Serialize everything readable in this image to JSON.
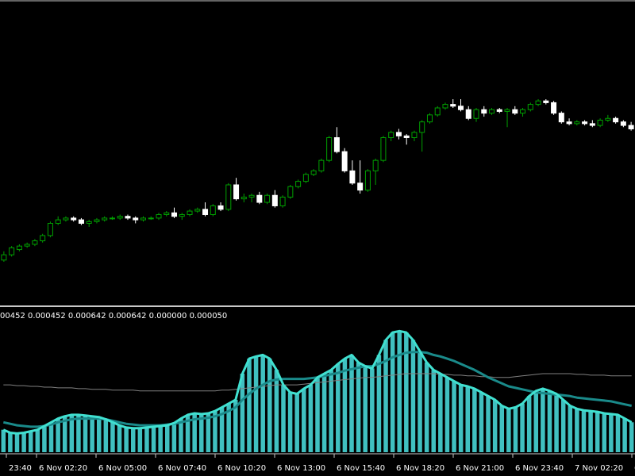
{
  "colors": {
    "background": "#000000",
    "frame": "#c8c8c8",
    "candle_up": "#00a000",
    "candle_down": "#ffffff",
    "histogram": "#40c0c0",
    "indicator_line": "#40e0d0",
    "signal_line": "#1a8a8a",
    "baseline_line": "#808080",
    "text": "#ffffff"
  },
  "indicator_readout": "00452 0.000452 0.000642 0.000642 0.000000 0.000050",
  "chart_data": [
    {
      "type": "candlestick",
      "title": "",
      "ohlc": [
        [
          0.28,
          0.33,
          0.27,
          0.31
        ],
        [
          0.31,
          0.36,
          0.3,
          0.35
        ],
        [
          0.34,
          0.37,
          0.33,
          0.36
        ],
        [
          0.36,
          0.38,
          0.35,
          0.37
        ],
        [
          0.37,
          0.4,
          0.36,
          0.39
        ],
        [
          0.39,
          0.43,
          0.38,
          0.42
        ],
        [
          0.42,
          0.5,
          0.41,
          0.49
        ],
        [
          0.49,
          0.53,
          0.48,
          0.51
        ],
        [
          0.51,
          0.53,
          0.5,
          0.52
        ],
        [
          0.52,
          0.53,
          0.5,
          0.51
        ],
        [
          0.51,
          0.52,
          0.48,
          0.49
        ],
        [
          0.49,
          0.51,
          0.47,
          0.5
        ],
        [
          0.5,
          0.52,
          0.49,
          0.51
        ],
        [
          0.51,
          0.53,
          0.5,
          0.52
        ],
        [
          0.52,
          0.53,
          0.51,
          0.52
        ],
        [
          0.52,
          0.54,
          0.51,
          0.53
        ],
        [
          0.53,
          0.54,
          0.51,
          0.52
        ],
        [
          0.52,
          0.53,
          0.49,
          0.51
        ],
        [
          0.51,
          0.53,
          0.5,
          0.52
        ],
        [
          0.52,
          0.53,
          0.51,
          0.52
        ],
        [
          0.52,
          0.55,
          0.51,
          0.54
        ],
        [
          0.54,
          0.56,
          0.53,
          0.55
        ],
        [
          0.55,
          0.58,
          0.52,
          0.53
        ],
        [
          0.53,
          0.55,
          0.51,
          0.54
        ],
        [
          0.54,
          0.57,
          0.53,
          0.56
        ],
        [
          0.56,
          0.58,
          0.55,
          0.57
        ],
        [
          0.57,
          0.61,
          0.53,
          0.54
        ],
        [
          0.54,
          0.6,
          0.53,
          0.59
        ],
        [
          0.59,
          0.61,
          0.56,
          0.57
        ],
        [
          0.57,
          0.72,
          0.56,
          0.71
        ],
        [
          0.71,
          0.75,
          0.62,
          0.63
        ],
        [
          0.63,
          0.66,
          0.61,
          0.64
        ],
        [
          0.64,
          0.66,
          0.61,
          0.65
        ],
        [
          0.65,
          0.67,
          0.6,
          0.61
        ],
        [
          0.61,
          0.66,
          0.6,
          0.65
        ],
        [
          0.65,
          0.68,
          0.58,
          0.59
        ],
        [
          0.59,
          0.65,
          0.58,
          0.64
        ],
        [
          0.64,
          0.71,
          0.63,
          0.7
        ],
        [
          0.7,
          0.74,
          0.69,
          0.73
        ],
        [
          0.73,
          0.78,
          0.72,
          0.77
        ],
        [
          0.77,
          0.8,
          0.76,
          0.79
        ],
        [
          0.79,
          0.86,
          0.78,
          0.85
        ],
        [
          0.85,
          0.99,
          0.84,
          0.98
        ],
        [
          0.98,
          1.04,
          0.89,
          0.9
        ],
        [
          0.9,
          0.92,
          0.78,
          0.79
        ],
        [
          0.79,
          0.85,
          0.71,
          0.72
        ],
        [
          0.72,
          0.85,
          0.66,
          0.68
        ],
        [
          0.68,
          0.8,
          0.67,
          0.79
        ],
        [
          0.79,
          0.86,
          0.71,
          0.85
        ],
        [
          0.85,
          0.99,
          0.84,
          0.98
        ],
        [
          0.98,
          1.02,
          0.96,
          1.01
        ],
        [
          1.01,
          1.03,
          0.97,
          0.99
        ],
        [
          0.99,
          1.0,
          0.94,
          0.98
        ],
        [
          0.98,
          1.02,
          0.96,
          1.01
        ],
        [
          1.01,
          1.08,
          0.9,
          1.07
        ],
        [
          1.07,
          1.12,
          1.06,
          1.11
        ],
        [
          1.11,
          1.16,
          1.1,
          1.15
        ],
        [
          1.15,
          1.18,
          1.14,
          1.17
        ],
        [
          1.17,
          1.2,
          1.15,
          1.16
        ],
        [
          1.16,
          1.2,
          1.13,
          1.14
        ],
        [
          1.14,
          1.16,
          1.08,
          1.09
        ],
        [
          1.09,
          1.15,
          1.07,
          1.14
        ],
        [
          1.14,
          1.16,
          1.1,
          1.12
        ],
        [
          1.12,
          1.15,
          1.11,
          1.14
        ],
        [
          1.14,
          1.15,
          1.12,
          1.13
        ],
        [
          1.13,
          1.15,
          1.04,
          1.14
        ],
        [
          1.14,
          1.16,
          1.11,
          1.12
        ],
        [
          1.12,
          1.15,
          1.1,
          1.14
        ],
        [
          1.14,
          1.18,
          1.13,
          1.17
        ],
        [
          1.17,
          1.2,
          1.16,
          1.19
        ],
        [
          1.19,
          1.2,
          1.17,
          1.18
        ],
        [
          1.18,
          1.19,
          1.11,
          1.12
        ],
        [
          1.12,
          1.13,
          1.06,
          1.07
        ],
        [
          1.07,
          1.09,
          1.05,
          1.06
        ],
        [
          1.06,
          1.08,
          1.05,
          1.07
        ],
        [
          1.07,
          1.08,
          1.05,
          1.06
        ],
        [
          1.06,
          1.08,
          1.04,
          1.05
        ],
        [
          1.05,
          1.09,
          1.04,
          1.08
        ],
        [
          1.08,
          1.11,
          1.07,
          1.09
        ],
        [
          1.09,
          1.1,
          1.06,
          1.07
        ],
        [
          1.07,
          1.08,
          1.04,
          1.05
        ],
        [
          1.05,
          1.07,
          1.02,
          1.03
        ]
      ]
    },
    {
      "type": "histogram",
      "title": "",
      "histogram": [
        0.3,
        0.26,
        0.25,
        0.26,
        0.28,
        0.3,
        0.35,
        0.4,
        0.45,
        0.48,
        0.5,
        0.5,
        0.49,
        0.48,
        0.47,
        0.44,
        0.4,
        0.36,
        0.33,
        0.32,
        0.32,
        0.33,
        0.34,
        0.35,
        0.36,
        0.39,
        0.45,
        0.5,
        0.52,
        0.51,
        0.52,
        0.55,
        0.6,
        0.65,
        0.7,
        1.05,
        1.25,
        1.28,
        1.3,
        1.25,
        1.1,
        0.9,
        0.8,
        0.78,
        0.85,
        0.9,
        1.0,
        1.05,
        1.1,
        1.18,
        1.25,
        1.3,
        1.2,
        1.15,
        1.12,
        1.3,
        1.5,
        1.6,
        1.62,
        1.6,
        1.5,
        1.35,
        1.2,
        1.1,
        1.05,
        1.0,
        0.95,
        0.9,
        0.88,
        0.85,
        0.8,
        0.75,
        0.7,
        0.62,
        0.58,
        0.6,
        0.65,
        0.75,
        0.82,
        0.85,
        0.82,
        0.78,
        0.7,
        0.62,
        0.58,
        0.56,
        0.55,
        0.54,
        0.52,
        0.51,
        0.5,
        0.45,
        0.4
      ],
      "indicator_line": [
        0.4,
        0.38,
        0.36,
        0.35,
        0.34,
        0.34,
        0.35,
        0.37,
        0.4,
        0.42,
        0.44,
        0.45,
        0.45,
        0.45,
        0.45,
        0.44,
        0.42,
        0.4,
        0.38,
        0.37,
        0.36,
        0.36,
        0.36,
        0.36,
        0.37,
        0.38,
        0.4,
        0.42,
        0.44,
        0.45,
        0.46,
        0.48,
        0.51,
        0.55,
        0.6,
        0.7,
        0.78,
        0.85,
        0.9,
        0.95,
        0.97,
        0.98,
        0.98,
        0.98,
        0.98,
        0.99,
        1.0,
        1.02,
        1.04,
        1.06,
        1.09,
        1.11,
        1.13,
        1.15,
        1.15,
        1.18,
        1.22,
        1.27,
        1.3,
        1.33,
        1.34,
        1.34,
        1.33,
        1.3,
        1.28,
        1.25,
        1.22,
        1.18,
        1.14,
        1.1,
        1.05,
        1.0,
        0.96,
        0.92,
        0.88,
        0.86,
        0.84,
        0.82,
        0.8,
        0.79,
        0.78,
        0.77,
        0.76,
        0.75,
        0.73,
        0.72,
        0.71,
        0.7,
        0.69,
        0.68,
        0.66,
        0.64,
        0.62
      ],
      "baseline_line": [
        0.9,
        0.9,
        0.89,
        0.89,
        0.88,
        0.88,
        0.87,
        0.87,
        0.86,
        0.86,
        0.86,
        0.85,
        0.85,
        0.84,
        0.84,
        0.84,
        0.83,
        0.83,
        0.83,
        0.83,
        0.82,
        0.82,
        0.82,
        0.82,
        0.82,
        0.82,
        0.82,
        0.82,
        0.82,
        0.82,
        0.82,
        0.82,
        0.83,
        0.83,
        0.84,
        0.85,
        0.86,
        0.87,
        0.88,
        0.89,
        0.9,
        0.9,
        0.9,
        0.9,
        0.91,
        0.92,
        0.93,
        0.94,
        0.95,
        0.96,
        0.97,
        0.98,
        0.99,
        1.0,
        1.0,
        1.01,
        1.02,
        1.03,
        1.04,
        1.05,
        1.05,
        1.05,
        1.05,
        1.05,
        1.04,
        1.04,
        1.03,
        1.03,
        1.02,
        1.02,
        1.01,
        1.01,
        1.0,
        1.0,
        1.0,
        1.01,
        1.02,
        1.03,
        1.04,
        1.05,
        1.05,
        1.05,
        1.05,
        1.05,
        1.04,
        1.04,
        1.03,
        1.03,
        1.03,
        1.02,
        1.02,
        1.02,
        1.02
      ],
      "ylim": [
        0,
        1.75
      ]
    }
  ],
  "time_axis": {
    "labels": [
      "23:40",
      "6 Nov 02:20",
      "6 Nov 05:00",
      "6 Nov 07:40",
      "6 Nov 10:20",
      "6 Nov 13:00",
      "6 Nov 15:40",
      "6 Nov 18:20",
      "6 Nov 21:00",
      "6 Nov 23:40",
      "7 Nov 02:20",
      "6 Nov"
    ]
  }
}
